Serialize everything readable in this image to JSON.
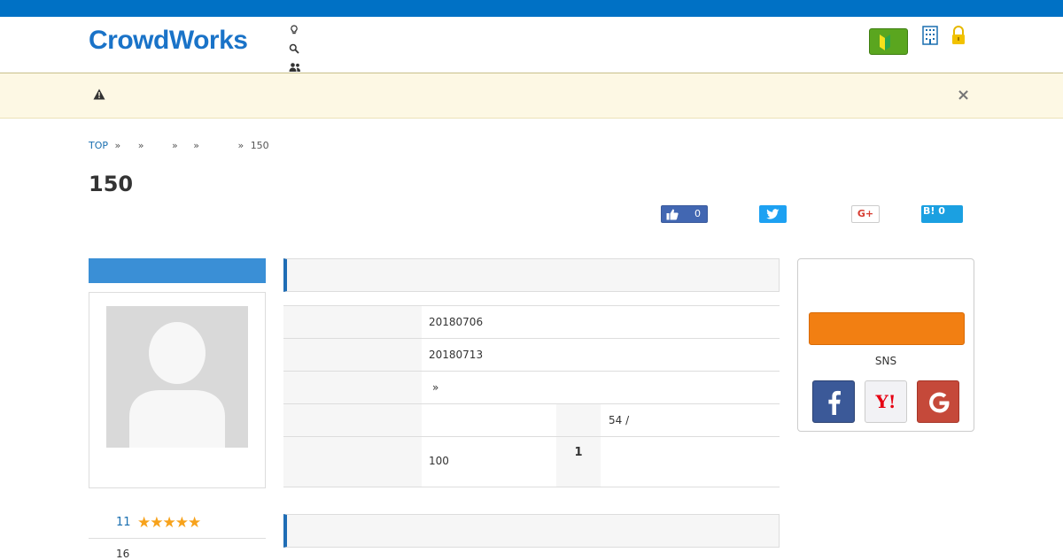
{
  "topbar": {
    "text": ""
  },
  "header": {
    "logo": "CrowdWorks",
    "nav": [
      {
        "label": "",
        "icon": "lightbulb-icon"
      },
      {
        "label": "",
        "icon": "search-icon"
      },
      {
        "label": "",
        "icon": "users-icon"
      }
    ],
    "beginner_label": "",
    "links": ""
  },
  "alert": {
    "close": "×"
  },
  "breadcrumb": {
    "top": "TOP",
    "separator": "»",
    "last": "150"
  },
  "page": {
    "title": "150"
  },
  "share": {
    "like_count": "0",
    "gplus": "G+",
    "hatena": "B! 0"
  },
  "sidebar": {
    "rating_count": "11",
    "stars": "★★★★★",
    "jobs_count": "16"
  },
  "detail": {
    "rows": [
      {
        "value": "20180706"
      },
      {
        "value": "20180713"
      },
      {
        "value": "»"
      },
      {
        "sub_value": "54 /"
      },
      {
        "value": "100",
        "sub_bold": "1"
      }
    ]
  },
  "register": {
    "sns_label": "SNS"
  },
  "colors": {
    "brand": "#0071c5",
    "accent": "#f27f12",
    "section": "#1f6db5"
  }
}
